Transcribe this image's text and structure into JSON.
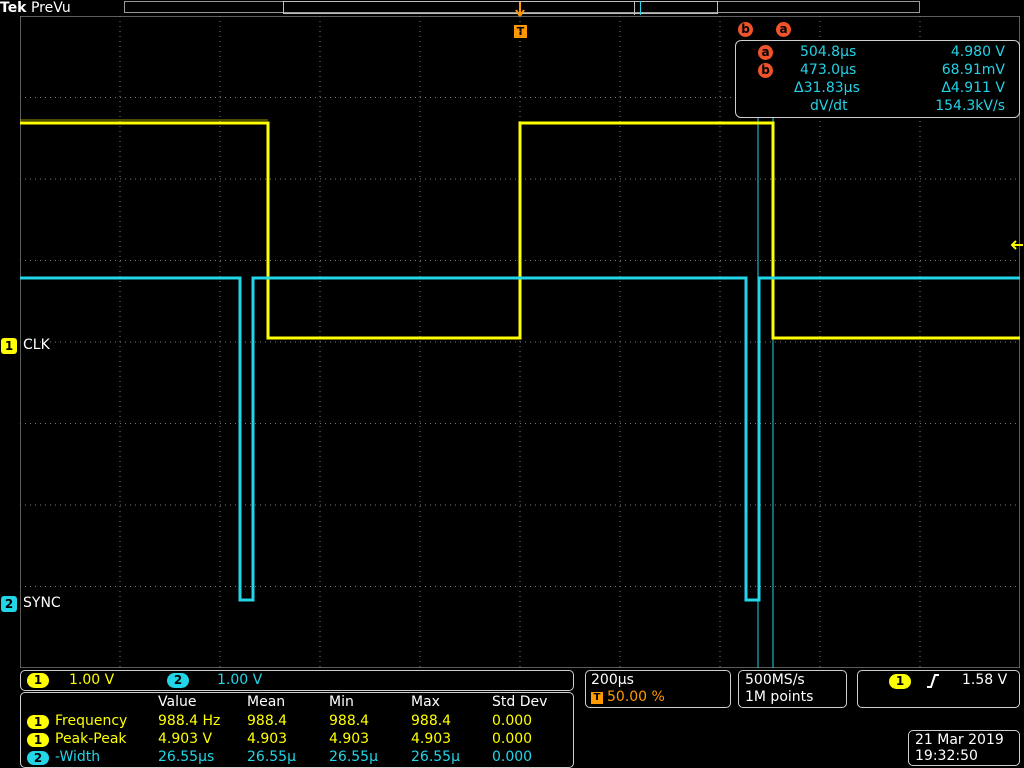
{
  "header": {
    "brand": "Tek",
    "mode": "PreVu"
  },
  "trigger_position_marker": "T",
  "cursor_readout": {
    "header_badges": [
      "b",
      "a"
    ],
    "rows": [
      {
        "badge": "a",
        "time": "504.8µs",
        "value": "4.980 V"
      },
      {
        "badge": "b",
        "time": "473.0µs",
        "value": "68.91mV"
      },
      {
        "badge": "",
        "time": "Δ31.83µs",
        "value": "Δ4.911 V"
      },
      {
        "badge": "",
        "time": "dV/dt",
        "value": "154.3kV/s"
      }
    ]
  },
  "channels": [
    {
      "number": "1",
      "name": "CLK",
      "color": "#ffff00"
    },
    {
      "number": "2",
      "name": "SYNC",
      "color": "#22d6e8"
    }
  ],
  "vertical_settings": [
    {
      "number": "1",
      "scale": "1.00 V"
    },
    {
      "number": "2",
      "scale": "1.00 V"
    }
  ],
  "horizontal": {
    "time_div": "200µs",
    "trigger_badge": "T",
    "trigger_pos": "50.00 %"
  },
  "acquisition": {
    "sample_rate": "500MS/s",
    "record_length": "1M points"
  },
  "trigger": {
    "source": "1",
    "slope_icon": "rising-edge-icon",
    "level": "1.58 V"
  },
  "measurements": {
    "headers": [
      "Value",
      "Mean",
      "Min",
      "Max",
      "Std Dev"
    ],
    "rows": [
      {
        "channel": "1",
        "name": "Frequency",
        "value": "988.4 Hz",
        "mean": "988.4",
        "min": "988.4",
        "max": "988.4",
        "std": "0.000"
      },
      {
        "channel": "1",
        "name": "Peak-Peak",
        "value": "4.903 V",
        "mean": "4.903",
        "min": "4.903",
        "max": "4.903",
        "std": "0.000"
      },
      {
        "channel": "2",
        "name": "-Width",
        "value": "26.55µs",
        "mean": "26.55µ",
        "min": "26.55µ",
        "max": "26.55µ",
        "std": "0.000"
      }
    ]
  },
  "datetime": {
    "date": "21 Mar 2019",
    "time": "19:32:50"
  },
  "colors": {
    "ch1": "#ffff00",
    "ch2": "#22d6e8",
    "cursor": "#f0532a",
    "grid": "#7a7a7a",
    "trigger": "#ff9900"
  }
}
